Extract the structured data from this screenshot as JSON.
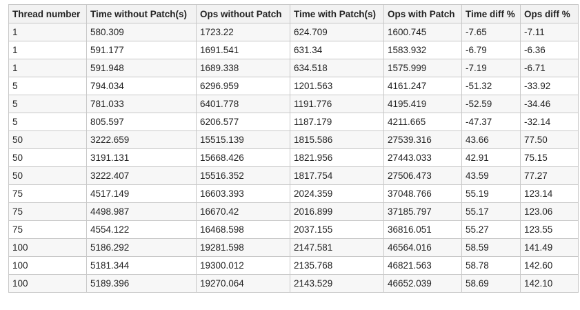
{
  "table": {
    "headers": [
      "Thread number",
      "Time without Patch(s)",
      "Ops without Patch",
      "Time with Patch(s)",
      "Ops with Patch",
      "Time diff %",
      "Ops diff %"
    ],
    "rows": [
      [
        "1",
        "580.309",
        "1723.22",
        "624.709",
        "1600.745",
        "-7.65",
        "-7.11"
      ],
      [
        "1",
        "591.177",
        "1691.541",
        "631.34",
        "1583.932",
        "-6.79",
        "-6.36"
      ],
      [
        "1",
        "591.948",
        "1689.338",
        "634.518",
        "1575.999",
        "-7.19",
        "-6.71"
      ],
      [
        "5",
        "794.034",
        "6296.959",
        "1201.563",
        "4161.247",
        "-51.32",
        "-33.92"
      ],
      [
        "5",
        "781.033",
        "6401.778",
        "1191.776",
        "4195.419",
        "-52.59",
        "-34.46"
      ],
      [
        "5",
        "805.597",
        "6206.577",
        "1187.179",
        "4211.665",
        "-47.37",
        "-32.14"
      ],
      [
        "50",
        "3222.659",
        "15515.139",
        "1815.586",
        "27539.316",
        "43.66",
        "77.50"
      ],
      [
        "50",
        "3191.131",
        "15668.426",
        "1821.956",
        "27443.033",
        "42.91",
        "75.15"
      ],
      [
        "50",
        "3222.407",
        "15516.352",
        "1817.754",
        "27506.473",
        "43.59",
        "77.27"
      ],
      [
        "75",
        "4517.149",
        "16603.393",
        "2024.359",
        "37048.766",
        "55.19",
        "123.14"
      ],
      [
        "75",
        "4498.987",
        "16670.42",
        "2016.899",
        "37185.797",
        "55.17",
        "123.06"
      ],
      [
        "75",
        "4554.122",
        "16468.598",
        "2037.155",
        "36816.051",
        "55.27",
        "123.55"
      ],
      [
        "100",
        "5186.292",
        "19281.598",
        "2147.581",
        "46564.016",
        "58.59",
        "141.49"
      ],
      [
        "100",
        "5181.344",
        "19300.012",
        "2135.768",
        "46821.563",
        "58.78",
        "142.60"
      ],
      [
        "100",
        "5189.396",
        "19270.064",
        "2143.529",
        "46652.039",
        "58.69",
        "142.10"
      ]
    ]
  }
}
